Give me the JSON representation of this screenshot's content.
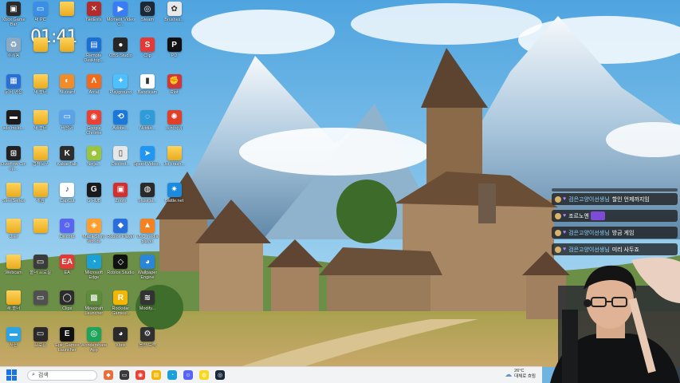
{
  "clock": {
    "time": "01:41"
  },
  "desktop_icons": [
    {
      "label": "Xbox Game Bar",
      "color": "#2a2a2a",
      "glyph": "▣",
      "col": 0,
      "row": 0
    },
    {
      "label": "내 PC",
      "color": "#3a8ee6",
      "glyph": "▭",
      "col": 1,
      "row": 0
    },
    {
      "label": "",
      "color": "folder",
      "glyph": "",
      "col": 2,
      "row": 0
    },
    {
      "label": "NetEnts",
      "color": "#b32b2b",
      "glyph": "✕",
      "col": 3,
      "row": 0
    },
    {
      "label": "Moment Video C...",
      "color": "#3b7cf6",
      "glyph": "▶",
      "col": 4,
      "row": 0
    },
    {
      "label": "Steam",
      "color": "#1b2838",
      "glyph": "◎",
      "col": 5,
      "row": 0
    },
    {
      "label": "Brushes...",
      "color": "#e8e8e8",
      "glyph": "✿",
      "col": 6,
      "row": 0
    },
    {
      "label": "휴지통",
      "color": "#8aa9c4",
      "glyph": "♻",
      "col": 0,
      "row": 1
    },
    {
      "label": "",
      "color": "folder",
      "glyph": "",
      "col": 1,
      "row": 1
    },
    {
      "label": "",
      "color": "folder",
      "glyph": "",
      "col": 2,
      "row": 1
    },
    {
      "label": "Remote Desktop...",
      "color": "#1d6fd1",
      "glyph": "▤",
      "col": 3,
      "row": 1
    },
    {
      "label": "OBS Studio",
      "color": "#262626",
      "glyph": "●",
      "col": 4,
      "row": 1
    },
    {
      "label": "Clip",
      "color": "#e53935",
      "glyph": "S",
      "col": 5,
      "row": 1
    },
    {
      "label": "PD",
      "color": "#111111",
      "glyph": "P",
      "col": 6,
      "row": 1
    },
    {
      "label": "문서 편집",
      "color": "#2b6fd6",
      "glyph": "▦",
      "col": 0,
      "row": 2
    },
    {
      "label": "새 폴더",
      "color": "folder",
      "glyph": "",
      "col": 1,
      "row": 2
    },
    {
      "label": "Blizzard",
      "color": "#f28c28",
      "glyph": "◐",
      "col": 2,
      "row": 2
    },
    {
      "label": "Arcal",
      "color": "#f26a1b",
      "glyph": "Λ",
      "col": 3,
      "row": 2
    },
    {
      "label": "Playground",
      "color": "#4ec0ff",
      "glyph": "✦",
      "col": 4,
      "row": 2
    },
    {
      "label": "Bandicam",
      "color": "#ffffff",
      "glyph": "▮",
      "col": 5,
      "row": 2
    },
    {
      "label": "Riot",
      "color": "#d13639",
      "glyph": "✊",
      "col": 6,
      "row": 2
    },
    {
      "label": "sdo mold...",
      "color": "#1d1d1d",
      "glyph": "▬",
      "col": 0,
      "row": 3
    },
    {
      "label": "새 폴더",
      "color": "folder",
      "glyph": "",
      "col": 1,
      "row": 3
    },
    {
      "label": "바탕화",
      "color": "#5aa3e8",
      "glyph": "▭",
      "col": 2,
      "row": 3
    },
    {
      "label": "Google Chrome",
      "color": "#e94235",
      "glyph": "◉",
      "col": 3,
      "row": 3
    },
    {
      "label": "Adobe...",
      "color": "#1b78d6",
      "glyph": "⟲",
      "col": 4,
      "row": 3
    },
    {
      "label": "Nvidia...",
      "color": "#2f9bd9",
      "glyph": "◌",
      "col": 5,
      "row": 3
    },
    {
      "label": "노티파이",
      "color": "#e0402a",
      "glyph": "✺",
      "col": 6,
      "row": 3
    },
    {
      "label": "Overflow Co-op...",
      "color": "#222222",
      "glyph": "⊞",
      "col": 0,
      "row": 4
    },
    {
      "label": "캡처도구",
      "color": "folder",
      "glyph": "",
      "col": 1,
      "row": 4
    },
    {
      "label": "KakaoTalk",
      "color": "#2d2d2d",
      "glyph": "K",
      "col": 2,
      "row": 4
    },
    {
      "label": "Ninja...",
      "color": "#9bc53d",
      "glyph": "☻",
      "col": 3,
      "row": 4
    },
    {
      "label": "Discord...",
      "color": "#e7e7e7",
      "glyph": "▯",
      "col": 4,
      "row": 4
    },
    {
      "label": "Speed Video...",
      "color": "#2196f3",
      "glyph": "➤",
      "col": 5,
      "row": 4
    },
    {
      "label": "Jst crash...",
      "color": "folder",
      "glyph": "",
      "col": 6,
      "row": 4
    },
    {
      "label": "SteelSeries",
      "color": "folder",
      "glyph": "",
      "col": 0,
      "row": 5
    },
    {
      "label": "게임",
      "color": "folder",
      "glyph": "",
      "col": 1,
      "row": 5
    },
    {
      "label": "CapCut",
      "color": "#ffffff",
      "glyph": "♪",
      "col": 2,
      "row": 5
    },
    {
      "label": "G HUB",
      "color": "#1a1a1a",
      "glyph": "G",
      "col": 3,
      "row": 5
    },
    {
      "label": "Zoom",
      "color": "#d32f2f",
      "glyph": "▣",
      "col": 4,
      "row": 5
    },
    {
      "label": "Musical...",
      "color": "#2a2a2a",
      "glyph": "◍",
      "col": 5,
      "row": 5
    },
    {
      "label": "Battle.net",
      "color": "#1a8bdf",
      "glyph": "✷",
      "col": 6,
      "row": 5
    },
    {
      "label": "User",
      "color": "folder",
      "glyph": "",
      "col": 0,
      "row": 6
    },
    {
      "label": "",
      "color": "folder",
      "glyph": "",
      "col": 1,
      "row": 6
    },
    {
      "label": "Discord",
      "color": "#5865f2",
      "glyph": "☺",
      "col": 2,
      "row": 6
    },
    {
      "label": "MapleStory Worlds",
      "color": "#ff9e2c",
      "glyph": "◈",
      "col": 3,
      "row": 6
    },
    {
      "label": "Roblox Player",
      "color": "#2a6edb",
      "glyph": "◆",
      "col": 4,
      "row": 6
    },
    {
      "label": "VLC media player",
      "color": "#f58220",
      "glyph": "▲",
      "col": 5,
      "row": 6
    },
    {
      "label": "Webcam",
      "color": "folder",
      "glyph": "",
      "col": 0,
      "row": 7
    },
    {
      "label": "폴더 프로필",
      "color": "#3b3b3b",
      "glyph": "▭",
      "col": 1,
      "row": 7
    },
    {
      "label": "EA",
      "color": "#e53935",
      "glyph": "EA",
      "col": 2,
      "row": 7
    },
    {
      "label": "Microsoft Edge",
      "color": "#1aa1d8",
      "glyph": "◔",
      "col": 3,
      "row": 7
    },
    {
      "label": "Roblox Studio",
      "color": "#111111",
      "glyph": "◇",
      "col": 4,
      "row": 7
    },
    {
      "label": "Wallpaper Engine",
      "color": "#2a86d9",
      "glyph": "◕",
      "col": 5,
      "row": 7
    },
    {
      "label": "새 폴더",
      "color": "folder",
      "glyph": "",
      "col": 0,
      "row": 8
    },
    {
      "label": "",
      "color": "#505050",
      "glyph": "▭",
      "col": 1,
      "row": 8
    },
    {
      "label": "Clips",
      "color": "#2c2c2c",
      "glyph": "◯",
      "col": 2,
      "row": 8
    },
    {
      "label": "Minecraft Launcher",
      "color": "#5c8d3a",
      "glyph": "▩",
      "col": 3,
      "row": 8
    },
    {
      "label": "Rockstar Games...",
      "color": "#f2b705",
      "glyph": "R",
      "col": 4,
      "row": 8
    },
    {
      "label": "Modify...",
      "color": "#333333",
      "glyph": "≋",
      "col": 5,
      "row": 8
    },
    {
      "label": "사진",
      "color": "#2aa4e6",
      "glyph": "▬",
      "col": 0,
      "row": 9
    },
    {
      "label": "프로필",
      "color": "#2a2a2a",
      "glyph": "▭",
      "col": 1,
      "row": 9
    },
    {
      "label": "Epic Games Launcher",
      "color": "#111111",
      "glyph": "E",
      "col": 2,
      "row": 9
    },
    {
      "label": "Wondershare App",
      "color": "#1ea35b",
      "glyph": "◎",
      "col": 3,
      "row": 9
    },
    {
      "label": "Xbox",
      "color": "#2a2a2a",
      "glyph": "◕",
      "col": 4,
      "row": 9
    },
    {
      "label": "음량 트랙",
      "color": "#303030",
      "glyph": "⚙",
      "col": 5,
      "row": 9
    }
  ],
  "chat": {
    "messages": [
      {
        "nick": "검은고양이선생님",
        "text": "할인 언제까지임",
        "emote": false
      },
      {
        "nick": "",
        "text": "조르노엔",
        "emote": true
      },
      {
        "nick": "검은고양이선생님",
        "text": "방금 게임",
        "emote": false
      },
      {
        "nick": "검은고양이선생님",
        "text": "미리 사두죠",
        "emote": false
      }
    ],
    "nick_color": "#8fd3ff",
    "bg_color": "#1e1e1e"
  },
  "taskbar": {
    "search_placeholder": "검색",
    "apps": [
      {
        "icon": "game-icon",
        "color": "#e76f3c",
        "glyph": "◆"
      },
      {
        "icon": "task-view-icon",
        "color": "#3a3a3a",
        "glyph": "▭"
      },
      {
        "icon": "chrome-icon",
        "color": "#e94235",
        "glyph": "◉"
      },
      {
        "icon": "file-explorer-icon",
        "color": "#f2b705",
        "glyph": "▤"
      },
      {
        "icon": "edge-icon",
        "color": "#1aa1d8",
        "glyph": "◔"
      },
      {
        "icon": "discord-icon",
        "color": "#5865f2",
        "glyph": "☺"
      },
      {
        "icon": "kakaotalk-icon",
        "color": "#f9d71c",
        "glyph": "◍"
      },
      {
        "icon": "steam-icon",
        "color": "#1b2838",
        "glyph": "◎"
      }
    ],
    "weather": {
      "temp": "26°C",
      "desc": "대체로 흐림"
    }
  }
}
